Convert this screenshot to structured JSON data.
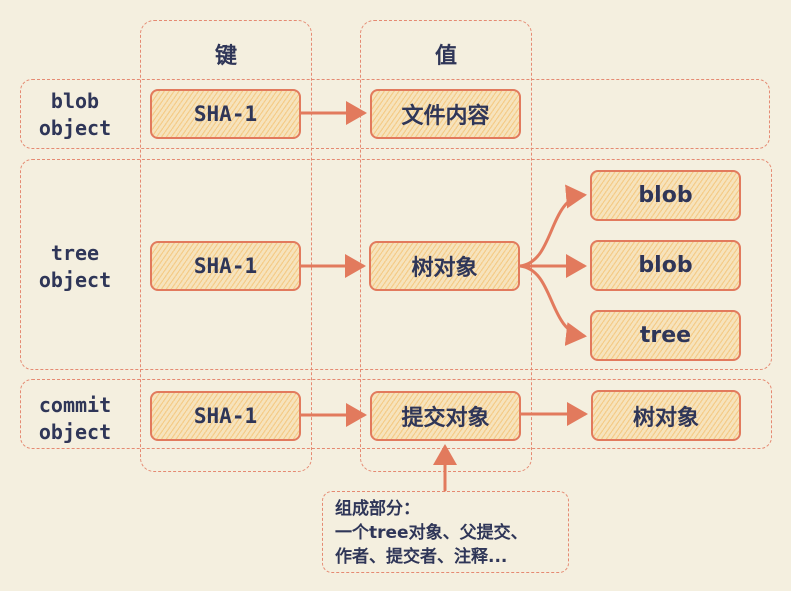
{
  "columns": {
    "key_header": "键",
    "value_header": "值"
  },
  "rows": [
    {
      "label_line1": "blob",
      "label_line2": "object",
      "key": "SHA-1",
      "value": "文件内容"
    },
    {
      "label_line1": "tree",
      "label_line2": "object",
      "key": "SHA-1",
      "value": "树对象",
      "children": [
        "blob",
        "blob",
        "tree"
      ]
    },
    {
      "label_line1": "commit",
      "label_line2": "object",
      "key": "SHA-1",
      "value": "提交对象",
      "target": "树对象"
    }
  ],
  "note": {
    "line1": "组成部分：",
    "line2": "一个tree对象、父提交、",
    "line3": "作者、提交者、注释..."
  },
  "colors": {
    "background": "#f4efdf",
    "accent": "#e27a5d",
    "box_fill": "#f6e3bd",
    "text": "#2f3658"
  }
}
